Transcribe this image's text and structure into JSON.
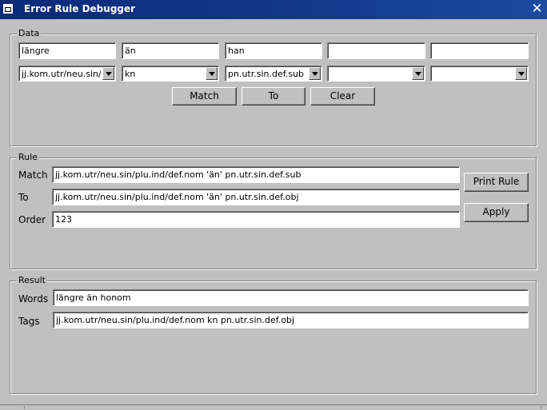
{
  "window": {
    "title": "Error Rule Debugger",
    "close_glyph": "✕"
  },
  "data_group": {
    "legend": "Data",
    "words": [
      "längre",
      "än",
      "han",
      "",
      ""
    ],
    "tags": [
      "jj.kom.utr/neu.sin/p",
      "kn",
      "pn.utr.sin.def.sub",
      "",
      ""
    ],
    "match_label": "Match",
    "to_label": "To",
    "clear_label": "Clear"
  },
  "rule_group": {
    "legend": "Rule",
    "match_label": "Match",
    "match_value": "jj.kom.utr/neu.sin/plu.ind/def.nom 'än' pn.utr.sin.def.sub",
    "to_label": "To",
    "to_value": "jj.kom.utr/neu.sin/plu.ind/def.nom 'än' pn.utr.sin.def.obj",
    "order_label": "Order",
    "order_value": "123",
    "print_rule_label": "Print Rule",
    "apply_label": "Apply"
  },
  "result_group": {
    "legend": "Result",
    "words_label": "Words",
    "words_value": "längre än honom",
    "tags_label": "Tags",
    "tags_value": "jj.kom.utr/neu.sin/plu.ind/def.nom kn pn.utr.sin.def.obj"
  }
}
